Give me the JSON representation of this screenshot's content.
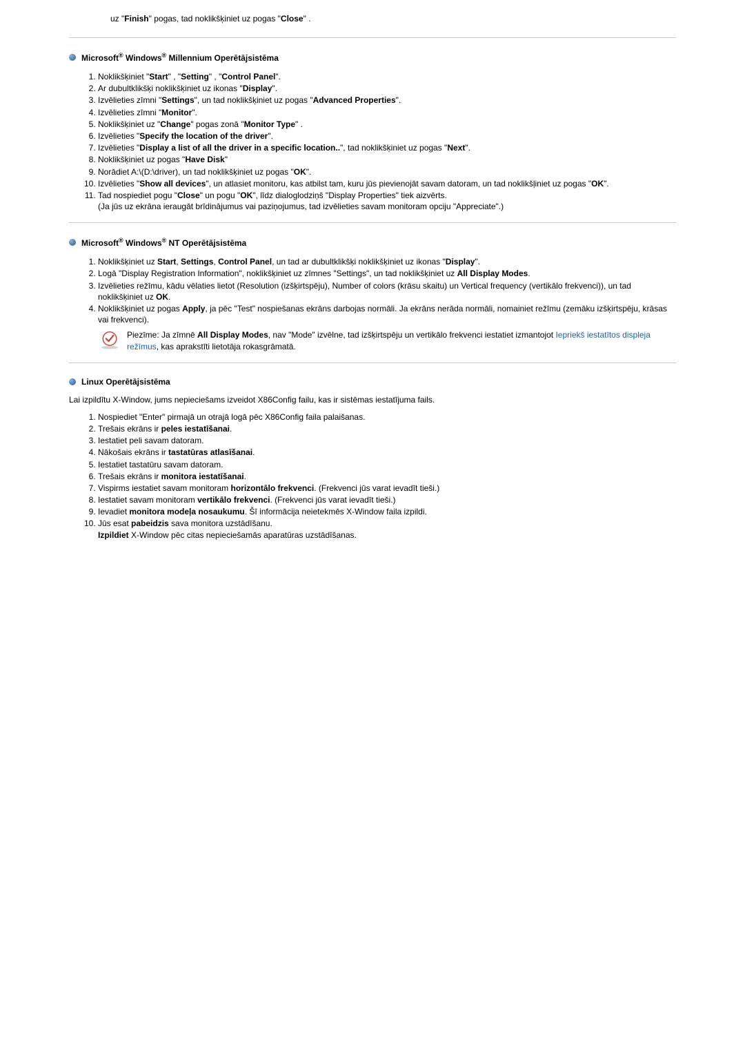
{
  "intro": "uz \"<b>Finish</b>\" pogas, tad noklikšķiniet uz pogas \"<b>Close</b>\" .",
  "sections": [
    {
      "title": "Microsoft<sup>®</sup> Windows<sup>®</sup> Millennium Operētājsistēma",
      "type": "ol",
      "items": [
        "Noklikšķiniet \"<b>Start</b>\" , \"<b>Setting</b>\" , \"<b>Control Panel</b>\".",
        "Ar dubultklikšķi noklikšķiniet uz ikonas \"<b>Display</b>\".",
        "Izvēlieties zīmni \"<b>Settings</b>\", un tad noklikšķiniet uz pogas \"<b>Advanced Properties</b>\".",
        "Izvēlieties zīmni \"<b>Monitor</b>\".",
        "Noklikšķiniet uz \"<b>Change</b>\" pogas zonā \"<b>Monitor Type</b>\" .",
        "Izvēlieties \"<b>Specify the location of the driver</b>\".",
        "Izvēlieties \"<b>Display a list of all the driver in a specific location..</b>\", tad noklikšķiniet uz pogas \"<b>Next</b>\".",
        "Noklikšķiniet uz pogas \"<b>Have Disk</b>\"",
        "Norādiet A:\\(D:\\driver), un tad noklikšķiniet uz pogas \"<b>OK</b>\".",
        "Izvēlieties \"<b>Show all devices</b>\", un atlasiet monitoru, kas atbilst tam, kuru jūs pievienojāt savam datoram, un tad noklikšļiniet uz pogas \"<b>OK</b>\".",
        "Tad nospiediet pogu \"<b>Close</b>\" un pogu \"<b>OK</b>\", līdz dialoglodziņš \"Display Properties\" tiek aizvērts.<br>(Ja jūs uz ekrāna ieraugāt brīdinājumus vai paziņojumus, tad izvēlieties savam monitoram opciju \"Appreciate\".)"
      ]
    },
    {
      "title": "Microsoft<sup>®</sup> Windows<sup>®</sup> NT Operētājsistēma",
      "type": "ol",
      "items": [
        "Noklikšķiniet uz <b>Start</b>, <b>Settings</b>, <b>Control Panel</b>, un tad ar dubultklikšķi noklikšķiniet uz ikonas \"<b>Display</b>\".",
        "Logā \"Display Registration Information\", noklikšķiniet uz zīmnes \"Settings\", un tad noklikšķiniet uz <b>All Display Modes</b>.",
        "Izvēlieties režīmu, kādu vēlaties lietot (Resolution (izšķirtspēju), Number of colors (krāsu skaitu) un Vertical frequency (vertikālo frekvenci)), un tad noklikšķiniet uz <b>OK</b>.",
        "Noklikšķiniet uz pogas <b>Apply</b>, ja pēc \"Test\" nospiešanas ekrāns darbojas normāli. Ja ekrāns nerāda normāli, nomainiet režīmu (zemāku izšķirtspēju, krāsas vai frekvenci)."
      ],
      "note": "Piezīme: Ja zīmnē <b>All Display Modes</b>, nav \"Mode\" izvēlne, tad izšķirtspēju un vertikālo frekvenci iestatiet izmantojot <a class=\"link\" href=\"#\">Iepriekš iestatītos displeja režīmus</a>, kas aprakstīti lietotāja rokasgrāmatā."
    },
    {
      "title": "Linux Operētājsistēma",
      "type": "para_ol",
      "para": "Lai izpildītu X-Window, jums nepieciešams izveidot X86Config failu, kas ir sistēmas iestatījuma fails.",
      "items": [
        "Nospiediet \"Enter\" pirmajā un otrajā logā pēc X86Config faila palaišanas.",
        "Trešais ekrāns ir <b>peles iestatīšanai</b>.",
        "Iestatiet peli savam datoram.",
        "Nākošais ekrāns ir <b>tastatūras atlasīšanai</b>.",
        "Iestatiet tastatūru savam datoram.",
        "Trešais ekrāns ir <b>monitora iestatīšanai</b>.",
        "Vispirms iestatiet savam monitoram <b>horizontālo frekvenci</b>. (Frekvenci jūs varat ievadīt tieši.)",
        "Iestatiet savam monitoram <b>vertikālo frekvenci</b>. (Frekvenci jūs varat ievadīt tieši.)",
        "Ievadiet <b>monitora modeļa nosaukumu</b>. Šī informācija neietekmēs X-Window faila izpildi.",
        "Jūs esat <b>pabeidzis</b> sava monitora uzstādīšanu.<br><b>Izpildiet</b> X-Window pēc citas nepieciešamās aparatūras uzstādīšanas."
      ]
    }
  ]
}
